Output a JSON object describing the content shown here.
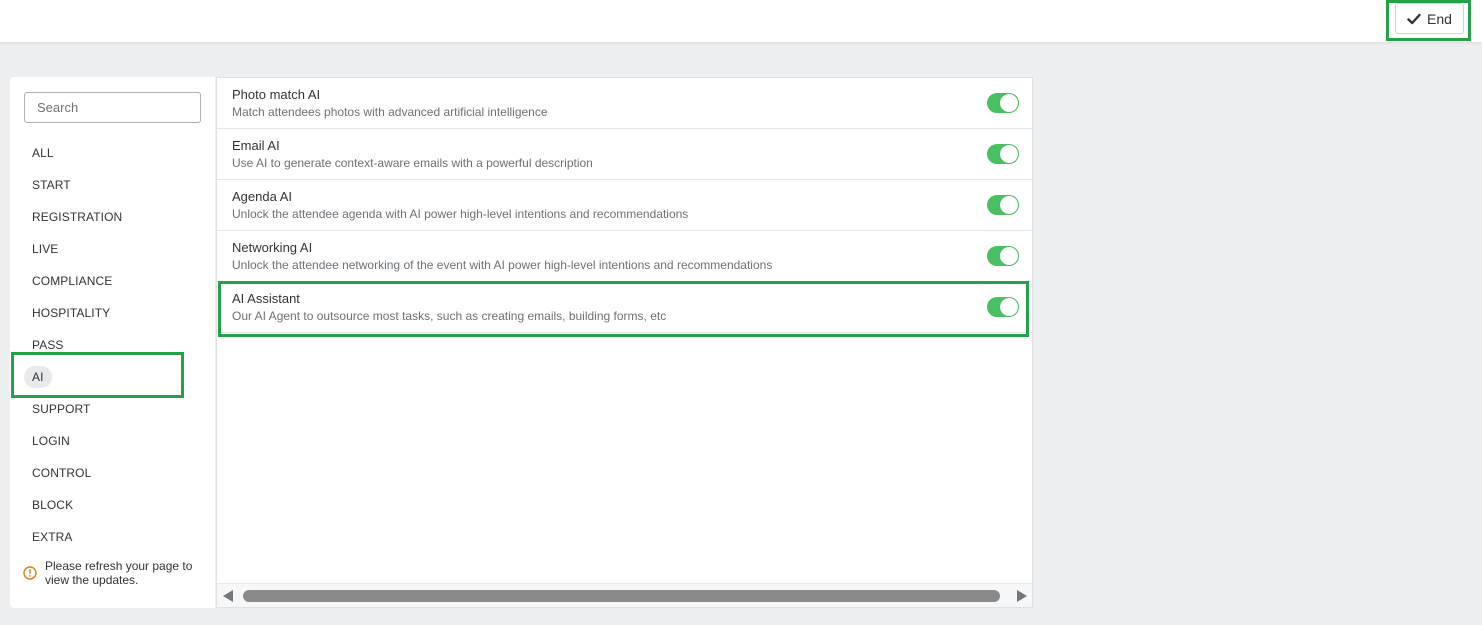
{
  "header": {
    "end_label": "End"
  },
  "sidebar": {
    "search_placeholder": "Search",
    "items": [
      {
        "label": "ALL"
      },
      {
        "label": "START"
      },
      {
        "label": "REGISTRATION"
      },
      {
        "label": "LIVE"
      },
      {
        "label": "COMPLIANCE"
      },
      {
        "label": "HOSPITALITY"
      },
      {
        "label": "PASS"
      },
      {
        "label": "AI"
      },
      {
        "label": "SUPPORT"
      },
      {
        "label": "LOGIN"
      },
      {
        "label": "CONTROL"
      },
      {
        "label": "BLOCK"
      },
      {
        "label": "EXTRA"
      }
    ],
    "active_item": "AI",
    "note": "Please refresh your page to view the updates."
  },
  "features": [
    {
      "title": "Photo match AI",
      "description": "Match attendees photos with advanced artificial intelligence",
      "enabled": true
    },
    {
      "title": "Email AI",
      "description": "Use AI to generate context-aware emails with a powerful description",
      "enabled": true
    },
    {
      "title": "Agenda AI",
      "description": "Unlock the attendee agenda with AI power high-level intentions and recommendations",
      "enabled": true
    },
    {
      "title": "Networking AI",
      "description": "Unlock the attendee networking of the event with AI power high-level intentions and recommendations",
      "enabled": true
    },
    {
      "title": "AI Assistant",
      "description": "Our AI Agent to outsource most tasks, such as creating emails, building forms, etc",
      "enabled": true
    }
  ],
  "colors": {
    "toggle_on": "#49c163",
    "highlight": "#24a247",
    "warning_icon": "#e07b12"
  }
}
